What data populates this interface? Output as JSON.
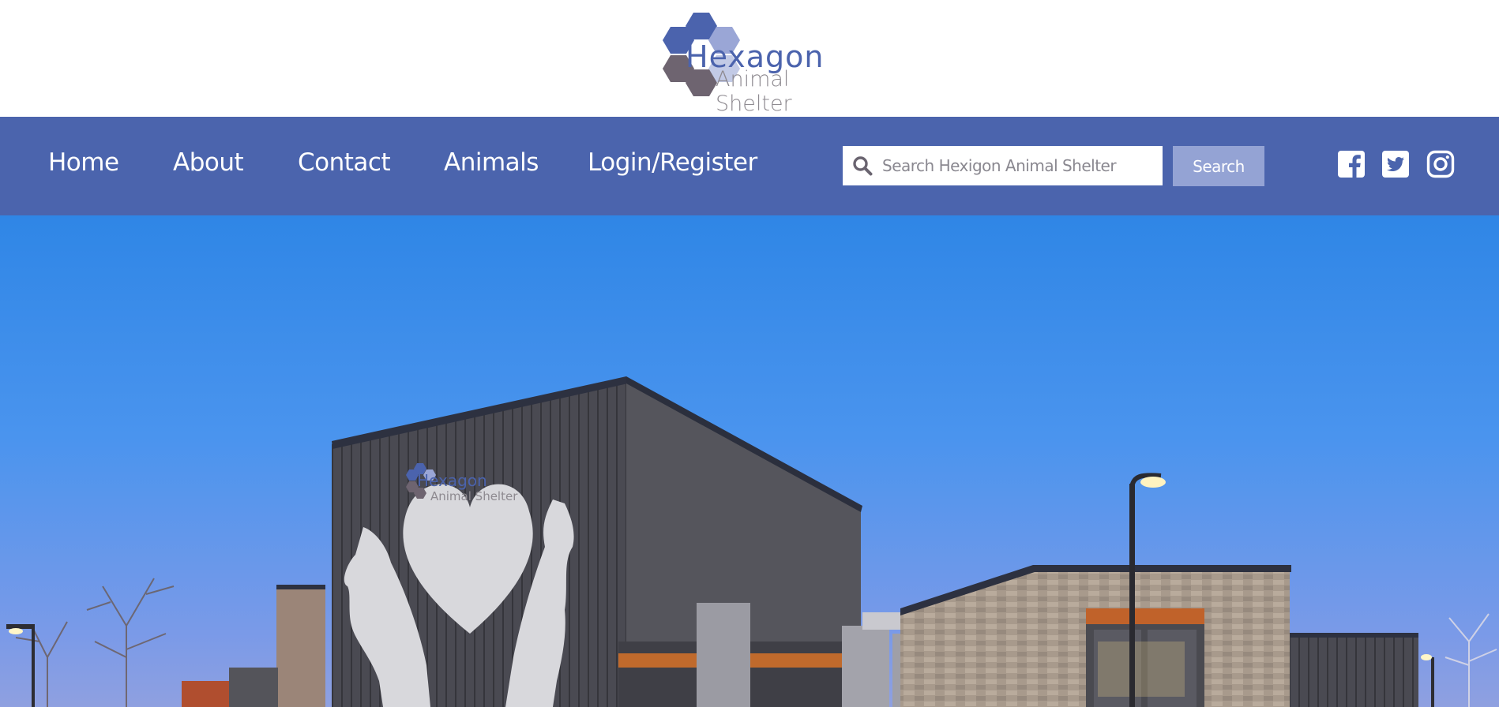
{
  "header": {
    "logo": {
      "name": "Hexagon",
      "subtitle": "Animal Shelter",
      "colors": {
        "blue": "#4b63ad",
        "light_blue": "#9aa6d6",
        "gray": "#6e6470"
      }
    }
  },
  "nav": {
    "items": [
      {
        "label": "Home"
      },
      {
        "label": "About"
      },
      {
        "label": "Contact"
      },
      {
        "label": "Animals"
      },
      {
        "label": "Login/Register"
      }
    ],
    "background": "#4b64ad"
  },
  "search": {
    "placeholder": "Search Hexigon Animal Shelter",
    "value": "",
    "button_label": "Search",
    "icon": "search-icon"
  },
  "social": [
    {
      "icon": "facebook-icon"
    },
    {
      "icon": "twitter-icon"
    },
    {
      "icon": "instagram-icon"
    }
  ],
  "hero": {
    "image": "shelter-building-photo",
    "sign_name": "Hexagon",
    "sign_subtitle": "Animal Shelter"
  }
}
